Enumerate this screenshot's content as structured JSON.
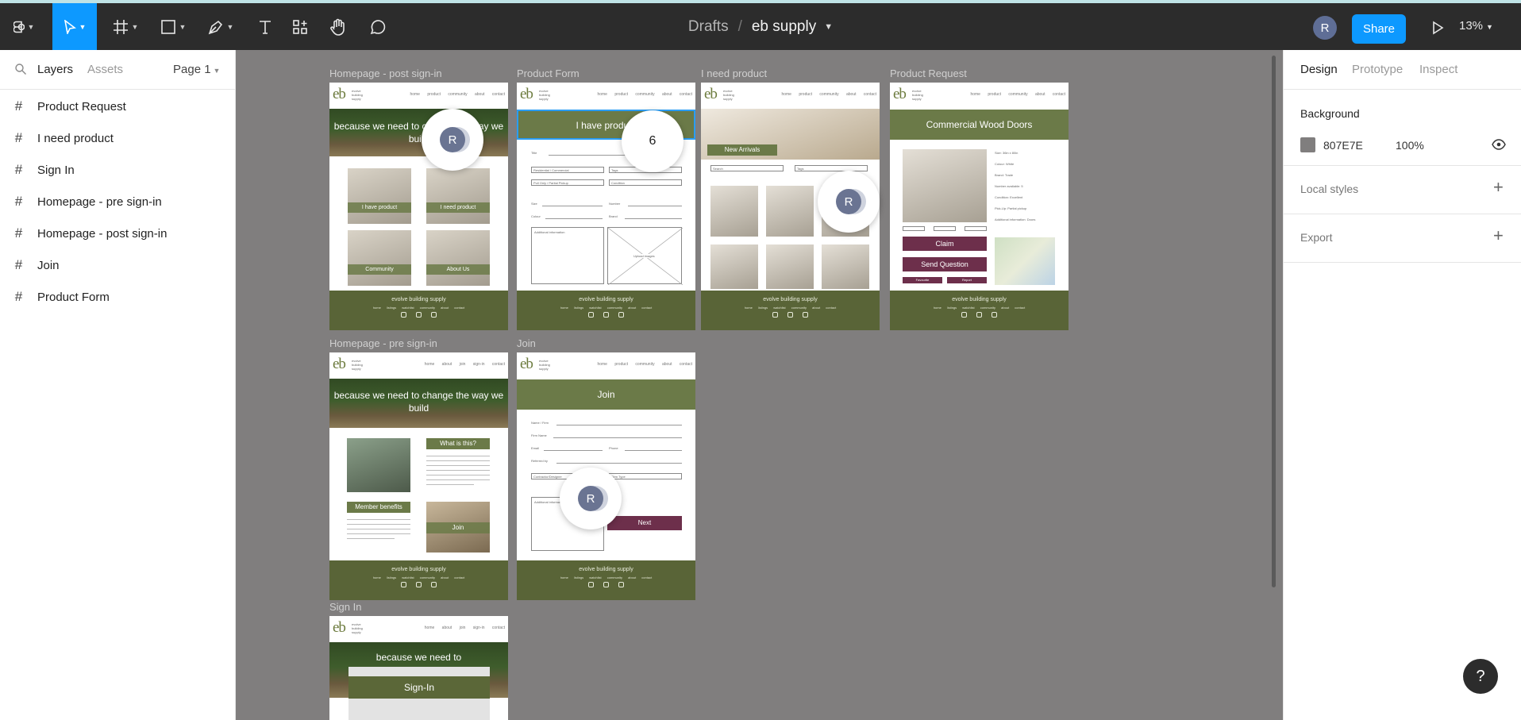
{
  "toolbar": {
    "file_parent": "Drafts",
    "separator": "/",
    "file_name": "eb supply",
    "user_initial": "R",
    "share_label": "Share",
    "zoom": "13%",
    "tools": [
      "main-menu",
      "move-tool",
      "frame-tool",
      "shape-tool",
      "pen-tool",
      "text-tool",
      "resources-tool",
      "hand-tool",
      "comment-tool"
    ]
  },
  "left_panel": {
    "tabs": {
      "layers": "Layers",
      "assets": "Assets",
      "page": "Page 1"
    },
    "layers": [
      "Product Request",
      "I need product",
      "Sign In",
      "Homepage - pre sign-in",
      "Homepage - post sign-in",
      "Join",
      "Product Form"
    ]
  },
  "right_panel": {
    "tabs": {
      "design": "Design",
      "prototype": "Prototype",
      "inspect": "Inspect"
    },
    "background": {
      "label": "Background",
      "hex": "807E7E",
      "opacity": "100%",
      "color": "#807E7E"
    },
    "local_styles": "Local styles",
    "export": "Export"
  },
  "canvas": {
    "frames": {
      "post": {
        "label": "Homepage - post sign-in",
        "hero": "because we need to change the way we build",
        "tiles": [
          "I have product",
          "I need product",
          "Community",
          "About Us"
        ]
      },
      "form": {
        "label": "Product Form",
        "banner": "I have product",
        "fields": [
          "Title",
          "Residential / Commercial",
          "Tags",
          "Pull Only / Partial Pickup",
          "Condition",
          "Size",
          "Number",
          "Colour",
          "Brand",
          "Additional information",
          "Upload images"
        ]
      },
      "need": {
        "label": "I need product",
        "banner": "New Arrivals",
        "fields": [
          "Search",
          "Tags"
        ]
      },
      "request": {
        "label": "Product Request",
        "banner": "Commercial Wood Doors",
        "specs": [
          "Size: 36in x 80in",
          "Colour: White",
          "Brand: Trade",
          "Number available: 5",
          "Condition: Excellent",
          "Pick-Up: Partial pickup",
          "Additional information: Doors"
        ],
        "claim": "Claim",
        "send": "Send Question",
        "favourite": "Favourite",
        "report": "Report"
      },
      "pre": {
        "label": "Homepage - pre sign-in",
        "hero": "because we need to change the way we build",
        "what": "What is this?",
        "benefits": "Member benefits",
        "join": "Join"
      },
      "join": {
        "label": "Join",
        "banner": "Join",
        "fields": [
          "Name / Firm",
          "Firm Name",
          "Email",
          "Phone",
          "Referred by",
          "Contractor/Designer",
          "Firm Type",
          "Additional information"
        ],
        "next": "Next"
      },
      "signin": {
        "label": "Sign In",
        "hero": "because we need to",
        "button": "Sign-In"
      }
    },
    "footer": {
      "brand": "evolve building supply",
      "links": "home listings watchlist community about contact"
    },
    "nav_links_signed": "home product community about contact",
    "nav_links_guest": "home about join sign-in contact",
    "logo": "eb",
    "logo_sub": "evolve building supply",
    "collab_initial": "R",
    "collab_count": "6"
  },
  "help": "?"
}
